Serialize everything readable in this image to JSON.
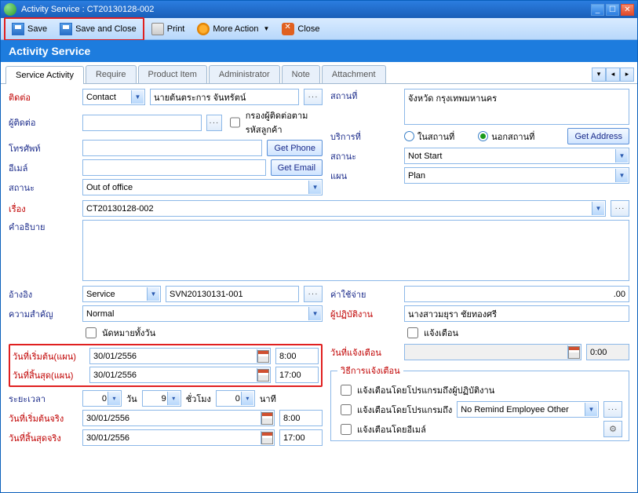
{
  "window": {
    "title": "Activity Service : CT20130128-002"
  },
  "toolbar": {
    "save": "Save",
    "save_close": "Save and Close",
    "print": "Print",
    "more": "More Action",
    "close": "Close"
  },
  "section": {
    "title": "Activity Service"
  },
  "tabs": [
    "Service Activity",
    "Require",
    "Product Item",
    "Administrator",
    "Note",
    "Attachment"
  ],
  "left": {
    "contact_lbl": "ติดต่อ",
    "contact_type": "Contact",
    "contact_name": "นายต้นตระการ จันทรัตน์",
    "relate_lbl": "ผู้ติดต่อ",
    "relate_val": "",
    "filter_cust": "กรองผู้ติดต่อตามรหัสลูกค้า",
    "phone_lbl": "โทรศัพท์",
    "phone_val": "",
    "get_phone": "Get Phone",
    "email_lbl": "อีเมล์",
    "email_val": "",
    "get_email": "Get Email",
    "status_lbl": "สถานะ",
    "status_val": "Out of office",
    "subject_lbl": "เรื่อง",
    "subject_val": "CT20130128-002",
    "desc_lbl": "คำอธิบาย",
    "desc_val": "",
    "ref_lbl": "อ้างอิง",
    "ref_type": "Service",
    "ref_val": "SVN20130131-001",
    "priority_lbl": "ความสำคัญ",
    "priority_val": "Normal",
    "allday": "นัดหมายทั้งวัน",
    "pstart_lbl": "วันที่เริ่มต้น(แผน)",
    "pstart_date": "30/01/2556",
    "pstart_time": "8:00",
    "pend_lbl": "วันที่สิ้นสุด(แผน)",
    "pend_date": "30/01/2556",
    "pend_time": "17:00",
    "dur_lbl": "ระยะเวลา",
    "dur_day": "0",
    "dur_day_u": "วัน",
    "dur_hr": "9",
    "dur_hr_u": "ชั่วโมง",
    "dur_min": "0",
    "dur_min_u": "นาที",
    "astart_lbl": "วันที่เริ่มต้นจริง",
    "astart_date": "30/01/2556",
    "astart_time": "8:00",
    "aend_lbl": "วันที่สิ้นสุดจริง",
    "aend_date": "30/01/2556",
    "aend_time": "17:00"
  },
  "right": {
    "loc_lbl": "สถานที่",
    "loc_val": "จังหวัด กรุงเทพมหานคร",
    "svc_lbl": "บริการที่",
    "onsite": "ในสถานที่",
    "offsite": "นอกสถานที่",
    "get_addr": "Get Address",
    "status_lbl": "สถานะ",
    "status_val": "Not Start",
    "plan_lbl": "แผน",
    "plan_val": "Plan",
    "cost_lbl": "ค่าใช้จ่าย",
    "cost_val": ".00",
    "assignee_lbl": "ผู้ปฏิบัติงาน",
    "assignee_val": "นางสาวมยุรา ชัยทองศรี",
    "remind": "แจ้งเตือน",
    "remind_date_lbl": "วันที่แจ้งเตือน",
    "remind_date": "",
    "remind_time": "0:00",
    "remind_group": "วิธีการแจ้งเตือน",
    "remind_prog_assignee": "แจ้งเตือนโดยโปรแกรมถึงผู้ปฏิบัติงาน",
    "remind_prog_to": "แจ้งเตือนโดยโปรแกรมถึง",
    "remind_prog_to_val": "No Remind Employee Other",
    "remind_email": "แจ้งเตือนโดยอีเมล์"
  }
}
